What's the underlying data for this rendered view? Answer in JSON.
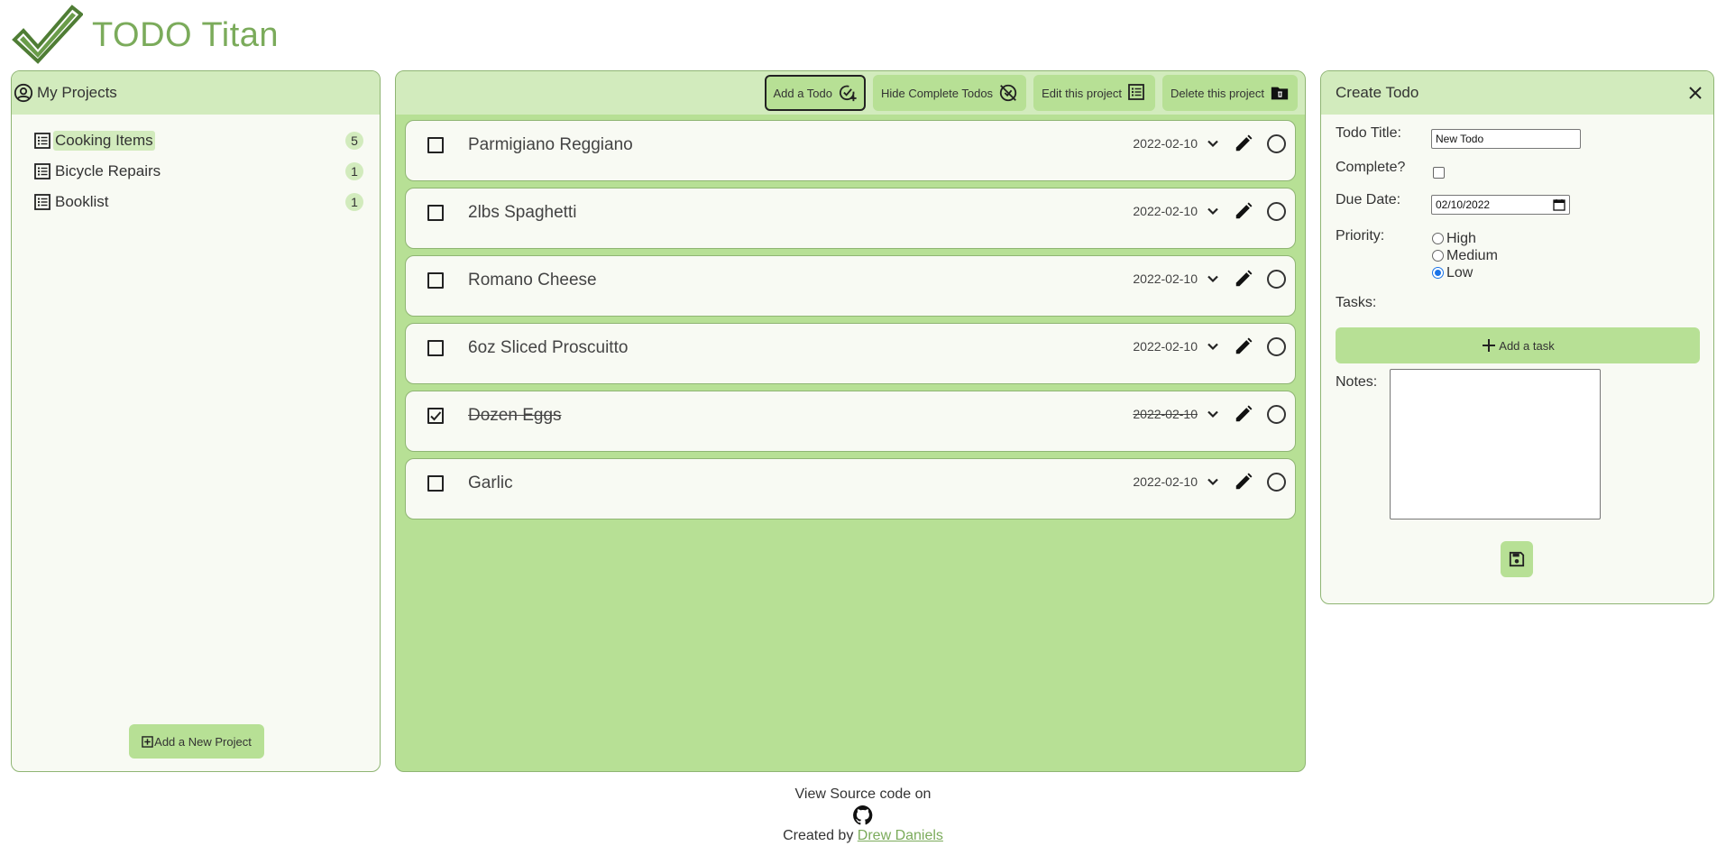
{
  "app": {
    "title": "TODO Titan"
  },
  "projects_panel": {
    "header": "My Projects",
    "items": [
      {
        "name": "Cooking Items",
        "count": "5",
        "active": true
      },
      {
        "name": "Bicycle Repairs",
        "count": "1",
        "active": false
      },
      {
        "name": "Booklist",
        "count": "1",
        "active": false
      }
    ],
    "add_button": "Add a New Project"
  },
  "toolbar": {
    "add_todo": "Add a Todo",
    "hide_complete": "Hide Complete Todos",
    "edit_project": "Edit this project",
    "delete_project": "Delete this project"
  },
  "todos": [
    {
      "title": "Parmigiano Reggiano",
      "date": "2022-02-10",
      "done": false
    },
    {
      "title": "2lbs Spaghetti",
      "date": "2022-02-10",
      "done": false
    },
    {
      "title": "Romano Cheese",
      "date": "2022-02-10",
      "done": false
    },
    {
      "title": "6oz Sliced Proscuitto",
      "date": "2022-02-10",
      "done": false
    },
    {
      "title": "Dozen Eggs",
      "date": "2022-02-10",
      "done": true
    },
    {
      "title": "Garlic",
      "date": "2022-02-10",
      "done": false
    }
  ],
  "create_form": {
    "header": "Create Todo",
    "title_label": "Todo Title:",
    "title_value": "New Todo",
    "complete_label": "Complete?",
    "due_label": "Due Date:",
    "due_value": "02/10/2022",
    "priority_label": "Priority:",
    "priority_options": [
      "High",
      "Medium",
      "Low"
    ],
    "priority_selected": "Low",
    "tasks_label": "Tasks:",
    "add_task": "Add a task",
    "notes_label": "Notes:"
  },
  "footer": {
    "view_source": "View Source code on",
    "created_by": "Created by",
    "author": "Drew Daniels"
  },
  "colors": {
    "accent": "#b7e095",
    "header": "#d2ebbd",
    "brand": "#7bab5b",
    "panel_bg": "#f8faf3",
    "border": "#8fb573"
  }
}
